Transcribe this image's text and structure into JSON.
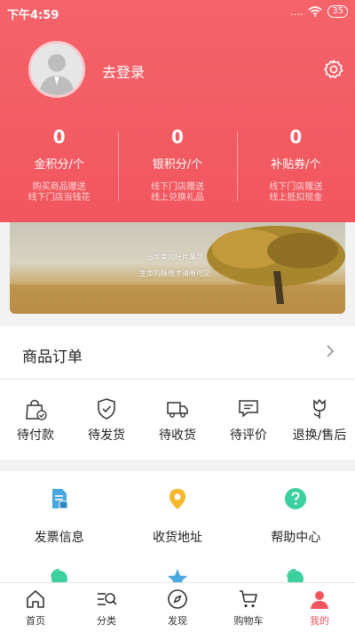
{
  "status_bar": {
    "time": "下午4:59",
    "signal": "....",
    "battery": "35"
  },
  "profile": {
    "login_text": "去登录"
  },
  "stats": [
    {
      "value": "0",
      "label": "金积分/个",
      "desc_line1": "购买商品赠送",
      "desc_line2": "线下门店当钱花"
    },
    {
      "value": "0",
      "label": "银积分/个",
      "desc_line1": "线下门店赠送",
      "desc_line2": "线上兑换礼品"
    },
    {
      "value": "0",
      "label": "补贴券/个",
      "desc_line1": "线下门店赠送",
      "desc_line2": "线上抵扣现金"
    }
  ],
  "banner": {
    "line1": "当华美的叶片落尽",
    "line2": "生命的脉络才清晰可见"
  },
  "orders": {
    "title": "商品订单",
    "items": [
      {
        "label": "待付款",
        "icon": "bag-icon"
      },
      {
        "label": "待发货",
        "icon": "shield-check-icon"
      },
      {
        "label": "待收货",
        "icon": "truck-icon"
      },
      {
        "label": "待评价",
        "icon": "comment-icon"
      },
      {
        "label": "退换/售后",
        "icon": "tulip-icon"
      }
    ]
  },
  "services": [
    {
      "label": "发票信息",
      "icon": "invoice-icon",
      "color": "#4aa8e0"
    },
    {
      "label": "收货地址",
      "icon": "location-icon",
      "color": "#f5b82e"
    },
    {
      "label": "帮助中心",
      "icon": "help-icon",
      "color": "#3ccfa0"
    }
  ],
  "tabs": [
    {
      "label": "首页",
      "icon": "home-icon"
    },
    {
      "label": "分类",
      "icon": "category-icon"
    },
    {
      "label": "发现",
      "icon": "compass-icon"
    },
    {
      "label": "购物车",
      "icon": "cart-icon"
    },
    {
      "label": "我的",
      "icon": "user-icon",
      "active": true
    }
  ],
  "colors": {
    "brand": "#f1565e",
    "tab_active": "#f1565e"
  }
}
